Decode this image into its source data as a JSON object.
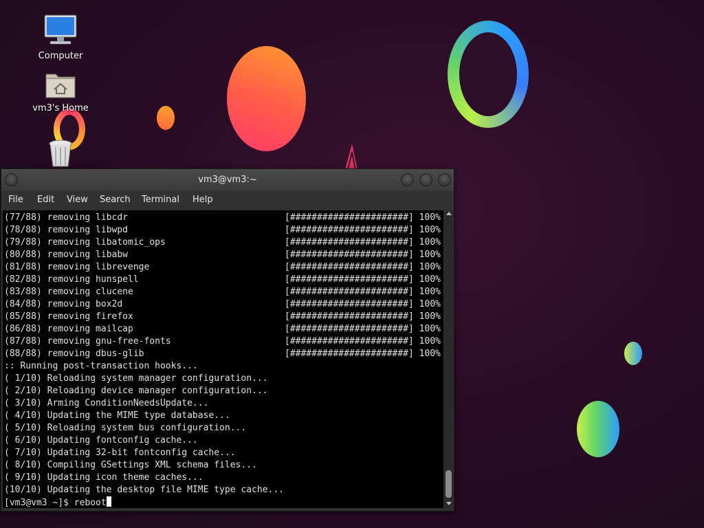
{
  "desktop": {
    "icons": [
      {
        "label": "Computer"
      },
      {
        "label": "vm3's Home"
      },
      {
        "label": ""
      }
    ]
  },
  "window": {
    "title": "vm3@vm3:~",
    "menu": [
      "File",
      "Edit",
      "View",
      "Search",
      "Terminal",
      "Help"
    ]
  },
  "terminal": {
    "removals": [
      {
        "text": "(77/88) removing libcdr",
        "bar": "[######################] 100%"
      },
      {
        "text": "(78/88) removing libwpd",
        "bar": "[######################] 100%"
      },
      {
        "text": "(79/88) removing libatomic_ops",
        "bar": "[######################] 100%"
      },
      {
        "text": "(80/88) removing libabw",
        "bar": "[######################] 100%"
      },
      {
        "text": "(81/88) removing librevenge",
        "bar": "[######################] 100%"
      },
      {
        "text": "(82/88) removing hunspell",
        "bar": "[######################] 100%"
      },
      {
        "text": "(83/88) removing clucene",
        "bar": "[######################] 100%"
      },
      {
        "text": "(84/88) removing box2d",
        "bar": "[######################] 100%"
      },
      {
        "text": "(85/88) removing firefox",
        "bar": "[######################] 100%"
      },
      {
        "text": "(86/88) removing mailcap",
        "bar": "[######################] 100%"
      },
      {
        "text": "(87/88) removing gnu-free-fonts",
        "bar": "[######################] 100%"
      },
      {
        "text": "(88/88) removing dbus-glib",
        "bar": "[######################] 100%"
      }
    ],
    "hooks": [
      ":: Running post-transaction hooks...",
      "( 1/10) Reloading system manager configuration...",
      "( 2/10) Reloading device manager configuration...",
      "( 3/10) Arming ConditionNeedsUpdate...",
      "( 4/10) Updating the MIME type database...",
      "( 5/10) Reloading system bus configuration...",
      "( 6/10) Updating fontconfig cache...",
      "( 7/10) Updating 32-bit fontconfig cache...",
      "( 8/10) Compiling GSettings XML schema files...",
      "( 9/10) Updating icon theme caches...",
      "(10/10) Updating the desktop file MIME type cache..."
    ],
    "prompt": "[vm3@vm3 ~]$ ",
    "command": "reboot"
  },
  "colors": {
    "wallpaper": "#2a0c25",
    "terminal_bg": "#000000",
    "terminal_fg": "#e0e0e0"
  }
}
